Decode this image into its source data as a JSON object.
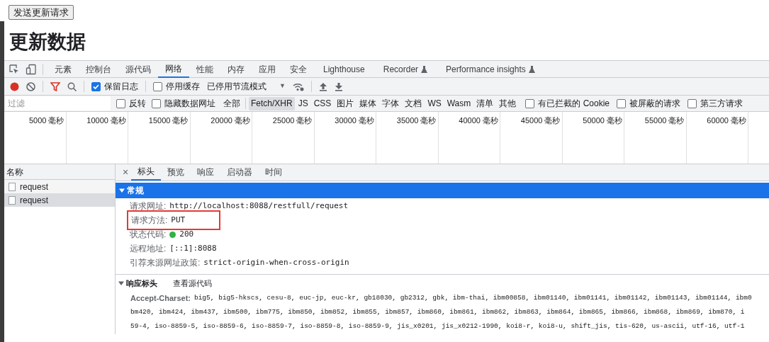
{
  "page": {
    "button": "发送更新请求",
    "heading": "更新数据"
  },
  "devtools": {
    "tabs": [
      {
        "label": "元素",
        "selected": false
      },
      {
        "label": "控制台",
        "selected": false
      },
      {
        "label": "源代码",
        "selected": false
      },
      {
        "label": "网络",
        "selected": true
      },
      {
        "label": "性能",
        "selected": false
      },
      {
        "label": "内存",
        "selected": false
      },
      {
        "label": "应用",
        "selected": false
      },
      {
        "label": "安全",
        "selected": false
      },
      {
        "label": "Lighthouse",
        "selected": false,
        "experimental": false
      },
      {
        "label": "Recorder",
        "selected": false,
        "experimental": true
      },
      {
        "label": "Performance insights",
        "selected": false,
        "experimental": true
      }
    ],
    "toolbar": {
      "preserve_log": {
        "label": "保留日志",
        "checked": true
      },
      "disable_cache": {
        "label": "停用缓存",
        "checked": false
      },
      "throttling": "已停用节流模式",
      "throttling_caret": "▼"
    },
    "filter": {
      "placeholder": "过滤",
      "options": [
        {
          "label": "反转",
          "checked": false
        },
        {
          "label": "隐藏数据网址",
          "checked": false
        }
      ],
      "types": [
        {
          "label": "全部",
          "selected": false
        },
        {
          "label": "Fetch/XHR",
          "selected": true
        },
        {
          "label": "JS",
          "selected": false
        },
        {
          "label": "CSS",
          "selected": false
        },
        {
          "label": "图片",
          "selected": false
        },
        {
          "label": "媒体",
          "selected": false
        },
        {
          "label": "字体",
          "selected": false
        },
        {
          "label": "文档",
          "selected": false
        },
        {
          "label": "WS",
          "selected": false
        },
        {
          "label": "Wasm",
          "selected": false
        },
        {
          "label": "清单",
          "selected": false
        },
        {
          "label": "其他",
          "selected": false
        }
      ],
      "extra_options": [
        {
          "label": "有已拦截的 Cookie",
          "checked": false
        },
        {
          "label": "被屏蔽的请求",
          "checked": false
        },
        {
          "label": "第三方请求",
          "checked": false
        }
      ]
    },
    "timeline": [
      "5000 毫秒",
      "10000 毫秒",
      "15000 毫秒",
      "20000 毫秒",
      "25000 毫秒",
      "30000 毫秒",
      "35000 毫秒",
      "40000 毫秒",
      "45000 毫秒",
      "50000 毫秒",
      "55000 毫秒",
      "60000 毫秒"
    ],
    "requests": {
      "header": "名称",
      "rows": [
        {
          "name": "request",
          "selected": false
        },
        {
          "name": "request",
          "selected": true
        }
      ]
    },
    "detail": {
      "close": "×",
      "tabs": [
        {
          "label": "标头",
          "selected": true
        },
        {
          "label": "预览",
          "selected": false
        },
        {
          "label": "响应",
          "selected": false
        },
        {
          "label": "启动器",
          "selected": false
        },
        {
          "label": "时间",
          "selected": false
        }
      ],
      "general": {
        "title": "常规",
        "expanded": true,
        "rows": [
          {
            "label": "请求网址:",
            "value": "http://localhost:8088/restfull/request",
            "highlighted": false
          },
          {
            "label": "请求方法:",
            "value": "PUT",
            "highlighted": true
          },
          {
            "label": "状态代码:",
            "value": "200",
            "color": "#2fb344",
            "highlighted": false
          },
          {
            "label": "远程地址:",
            "value": "[::1]:8088",
            "highlighted": false
          },
          {
            "label": "引荐来源网址政策:",
            "value": "strict-origin-when-cross-origin",
            "highlighted": false
          }
        ]
      },
      "response_headers": {
        "title": "响应标头",
        "expanded": true,
        "view_source": "查看源代码",
        "name": "Accept-Charset:",
        "lines": [
          "big5, big5-hkscs, cesu-8, euc-jp, euc-kr, gb18030, gb2312, gbk, ibm-thai, ibm00858, ibm01140, ibm01141, ibm01142, ibm01143, ibm01144, ibm0",
          "bm420, ibm424, ibm437, ibm500, ibm775, ibm850, ibm852, ibm855, ibm857, ibm860, ibm861, ibm862, ibm863, ibm864, ibm865, ibm866, ibm868, ibm869, ibm870, i",
          "59-4, iso-8859-5, iso-8859-6, iso-8859-7, iso-8859-8, iso-8859-9, jis_x0201, jis_x0212-1990, koi8-r, koi8-u, shift_jis, tis-620, us-ascii, utf-16, utf-1"
        ]
      }
    }
  }
}
